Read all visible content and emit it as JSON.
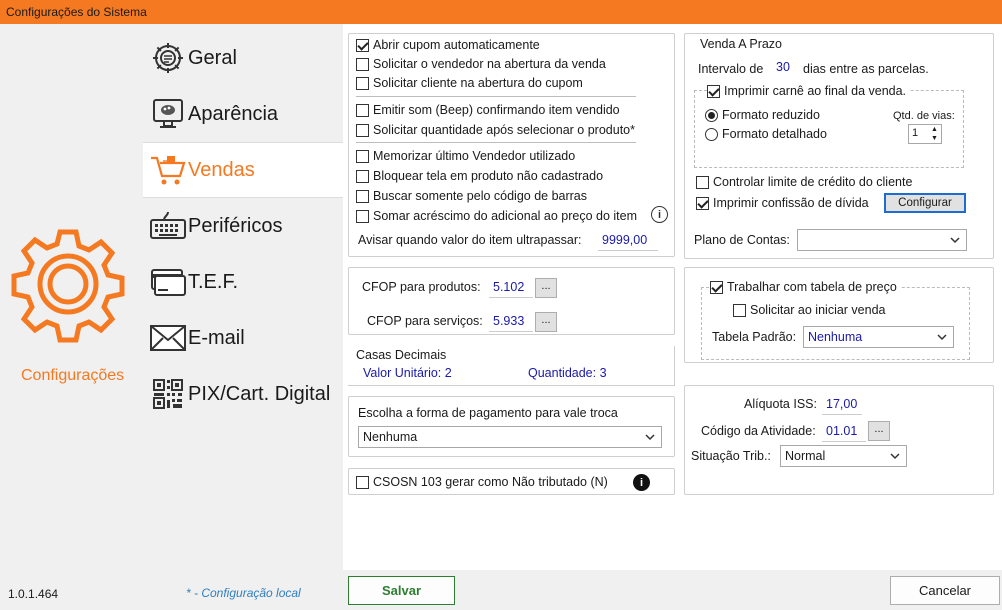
{
  "window": {
    "title": "Configurações do Sistema"
  },
  "sidebar": {
    "items": [
      {
        "label": "Geral",
        "icon": "gear-settings-icon"
      },
      {
        "label": "Aparência",
        "icon": "monitor-palette-icon"
      },
      {
        "label": "Vendas",
        "icon": "shopping-cart-icon"
      },
      {
        "label": "Periféricos",
        "icon": "keyboard-icon"
      },
      {
        "label": "T.E.F.",
        "icon": "credit-card-icon"
      },
      {
        "label": "E-mail",
        "icon": "envelope-icon"
      },
      {
        "label": "PIX/Cart. Digital",
        "icon": "qr-code-icon"
      }
    ],
    "active": "Vendas",
    "brand_label": "Configurações",
    "version": "1.0.1.464",
    "local_note": "* - Configuração local"
  },
  "options": {
    "abrir_cupom": "Abrir cupom automaticamente",
    "solicitar_vendedor": "Solicitar o vendedor na abertura da venda",
    "solicitar_cliente": "Solicitar cliente na abertura do cupom",
    "emitir_som": "Emitir som (Beep) confirmando item vendido",
    "solicitar_quantidade": "Solicitar quantidade após selecionar o produto*",
    "memorizar_vendedor": "Memorizar último Vendedor utilizado",
    "bloquear_tela": "Bloquear tela em produto não cadastrado",
    "buscar_codigo": "Buscar somente pelo código de barras",
    "somar_acrescimo": "Somar acréscimo do adicional ao preço do item",
    "avisar_label": "Avisar quando valor do item ultrapassar:",
    "avisar_value": "9999,00"
  },
  "cfop": {
    "produtos_label": "CFOP para produtos:",
    "produtos_value": "5.102",
    "servicos_label": "CFOP para serviços:",
    "servicos_value": "5.933",
    "dots": "..."
  },
  "casas": {
    "title": "Casas Decimais",
    "unit_label": "Valor Unitário:",
    "unit_value": "2",
    "qty_label": "Quantidade:",
    "qty_value": "3"
  },
  "vale_troca": {
    "label": "Escolha a forma de pagamento para vale troca",
    "value": "Nenhuma"
  },
  "csosn": {
    "label": "CSOSN 103 gerar como Não tributado (N)"
  },
  "venda_prazo": {
    "title": "Venda A Prazo",
    "intervalo_label": "Intervalo de",
    "intervalo_value": "30",
    "intervalo_suffix": "dias entre as parcelas.",
    "imprimir_carne": "Imprimir carnê ao final da venda.",
    "formato_reduzido": "Formato reduzido",
    "formato_detalhado": "Formato detalhado",
    "qtd_vias_label": "Qtd. de vias:",
    "qtd_vias_value": "1",
    "controlar_limite": "Controlar limite de crédito do cliente",
    "imprimir_confissao": "Imprimir confissão de dívida",
    "configurar": "Configurar",
    "plano_label": "Plano de Contas:",
    "plano_value": ""
  },
  "tabela_preco": {
    "trabalhar": "Trabalhar com tabela de preço",
    "solicitar": "Solicitar ao iniciar venda",
    "padrao_label": "Tabela Padrão:",
    "padrao_value": "Nenhuma"
  },
  "iss": {
    "aliquota_label": "Alíquota ISS:",
    "aliquota_value": "17,00",
    "codigo_label": "Código da Atividade:",
    "codigo_value": "01.01",
    "situacao_label": "Situação Trib.:",
    "situacao_value": "Normal"
  },
  "footer": {
    "save": "Salvar",
    "cancel": "Cancelar"
  },
  "colors": {
    "accent": "#f47920",
    "value_blue": "#1a1aa8",
    "save_border": "#2e7d32"
  }
}
